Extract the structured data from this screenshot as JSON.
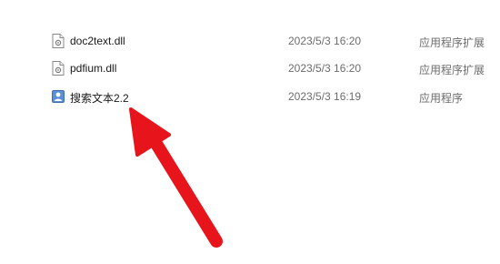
{
  "files": [
    {
      "name": "doc2text.dll",
      "date": "2023/5/3 16:20",
      "type": "应用程序扩展",
      "icon": "dll-file-icon"
    },
    {
      "name": "pdfium.dll",
      "date": "2023/5/3 16:20",
      "type": "应用程序扩展",
      "icon": "dll-file-icon"
    },
    {
      "name": "搜索文本2.2",
      "date": "2023/5/3 16:19",
      "type": "应用程序",
      "icon": "application-icon"
    }
  ],
  "annotation": {
    "color": "#e8141c",
    "icon": "red-arrow-annotation"
  }
}
